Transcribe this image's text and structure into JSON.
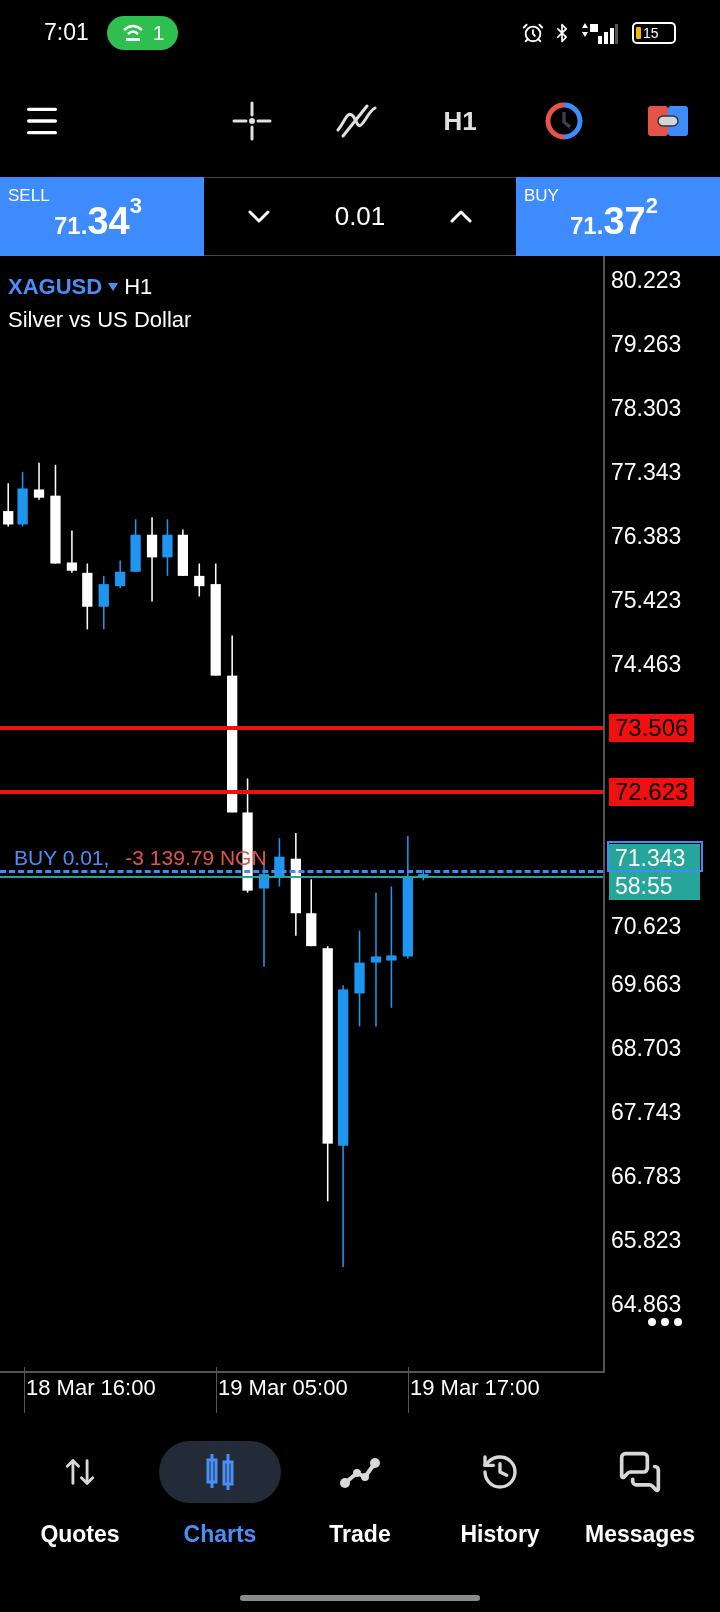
{
  "status_bar": {
    "time": "7:01",
    "hotspot_count": "1",
    "battery": "15"
  },
  "toolbar": {
    "timeframe": "H1"
  },
  "trade_panel": {
    "sell": {
      "label": "SELL",
      "price_head": "71.",
      "price_big": "34",
      "price_sup": "3"
    },
    "volume": "0.01",
    "buy": {
      "label": "BUY",
      "price_head": "71.",
      "price_big": "37",
      "price_sup": "2"
    }
  },
  "chart": {
    "symbol": "XAGUSD",
    "timeframe": "H1",
    "description": "Silver vs US Dollar",
    "price_axis": [
      {
        "kind": "tick",
        "text": "80.223"
      },
      {
        "kind": "tick",
        "text": "79.263"
      },
      {
        "kind": "tick",
        "text": "78.303"
      },
      {
        "kind": "tick",
        "text": "77.343"
      },
      {
        "kind": "tick",
        "text": "76.383"
      },
      {
        "kind": "tick",
        "text": "75.423"
      },
      {
        "kind": "tick",
        "text": "74.463"
      },
      {
        "kind": "level",
        "text": "73.506"
      },
      {
        "kind": "level",
        "text": "72.623"
      },
      {
        "kind": "current",
        "price": "71.343",
        "countdown": "58:55"
      },
      {
        "kind": "tick",
        "text": "70.623"
      },
      {
        "kind": "tick",
        "text": "69.663"
      },
      {
        "kind": "tick",
        "text": "68.703"
      },
      {
        "kind": "tick",
        "text": "67.743"
      },
      {
        "kind": "tick",
        "text": "66.783"
      },
      {
        "kind": "tick",
        "text": "65.823"
      },
      {
        "kind": "tick",
        "text": "64.863"
      }
    ],
    "position": {
      "label": "BUY 0.01,",
      "profit": "-3 139.79 NGN"
    },
    "time_axis": [
      "18 Mar 16:00",
      "19 Mar 05:00",
      "19 Mar 17:00"
    ]
  },
  "nav": [
    {
      "label": "Quotes",
      "selected": false
    },
    {
      "label": "Charts",
      "selected": true
    },
    {
      "label": "Trade",
      "selected": false
    },
    {
      "label": "History",
      "selected": false
    },
    {
      "label": "Messages",
      "selected": false
    }
  ]
}
